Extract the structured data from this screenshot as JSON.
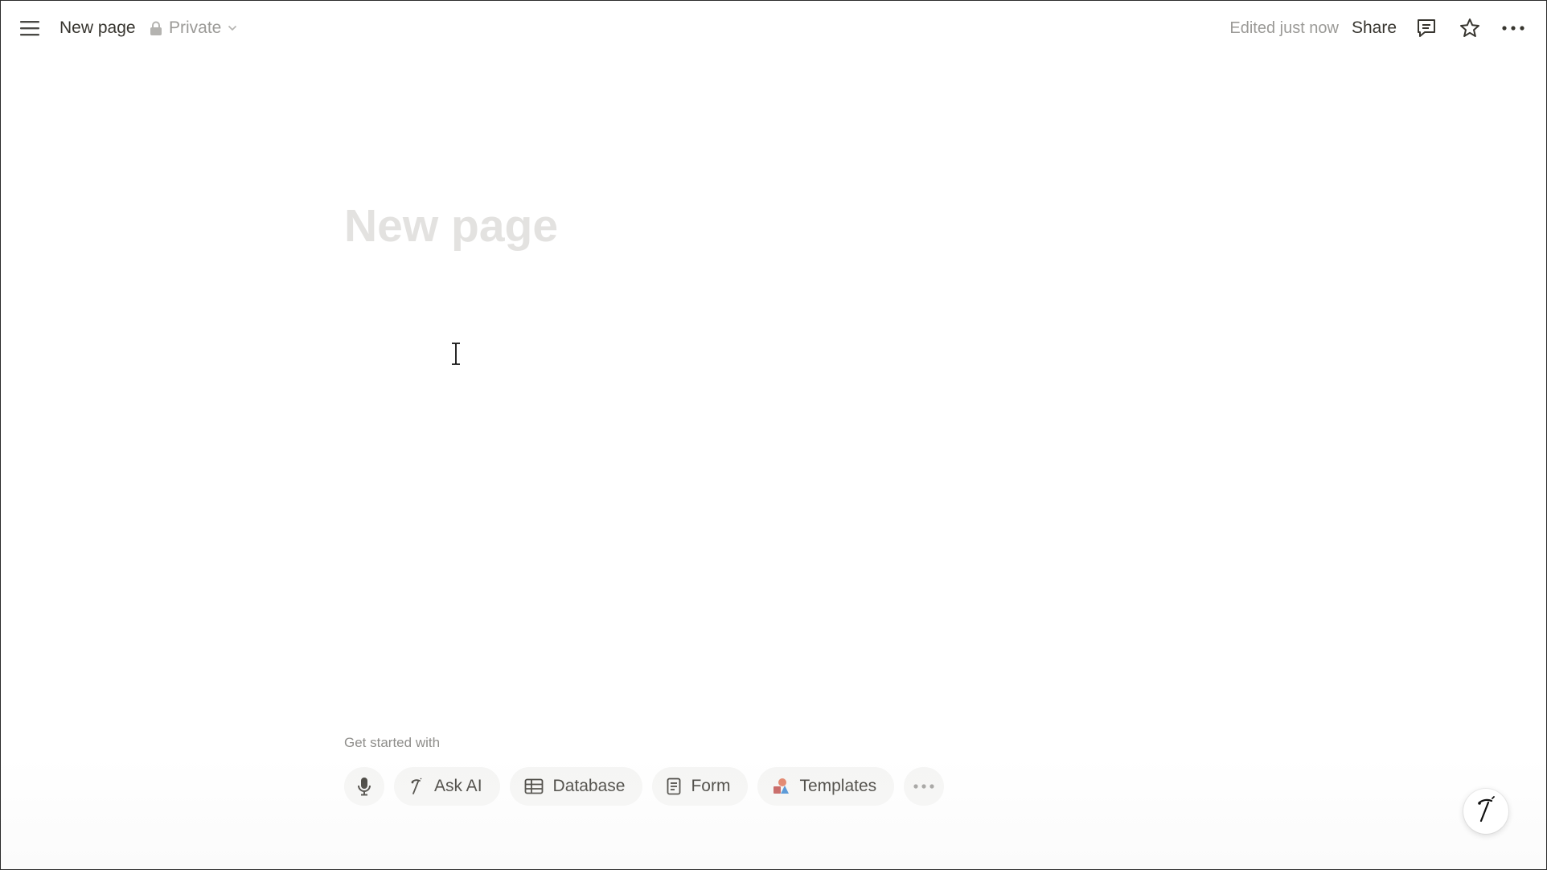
{
  "topbar": {
    "menu_icon": "hamburger-menu-icon",
    "page_title": "New page",
    "privacy_label": "Private",
    "privacy_icon": "lock-icon",
    "privacy_chevron": "chevron-down-icon",
    "edited_status": "Edited just now",
    "share_label": "Share",
    "comments_icon": "comment-icon",
    "favorite_icon": "star-icon",
    "more_icon": "more-horizontal-icon"
  },
  "page": {
    "title_placeholder": "New page",
    "get_started_label": "Get started with",
    "chips": [
      {
        "icon": "microphone-icon",
        "label": ""
      },
      {
        "icon": "notion-ai-icon",
        "label": "Ask AI"
      },
      {
        "icon": "table-icon",
        "label": "Database"
      },
      {
        "icon": "form-icon",
        "label": "Form"
      },
      {
        "icon": "templates-icon",
        "label": "Templates"
      },
      {
        "icon": "more-horizontal-icon",
        "label": ""
      }
    ],
    "floating_ai_icon": "notion-ai-icon"
  },
  "colors": {
    "text": "#37352f",
    "muted": "#9b9a97",
    "placeholder": "#e3e2e0",
    "chip_bg": "#f5f5f4"
  }
}
